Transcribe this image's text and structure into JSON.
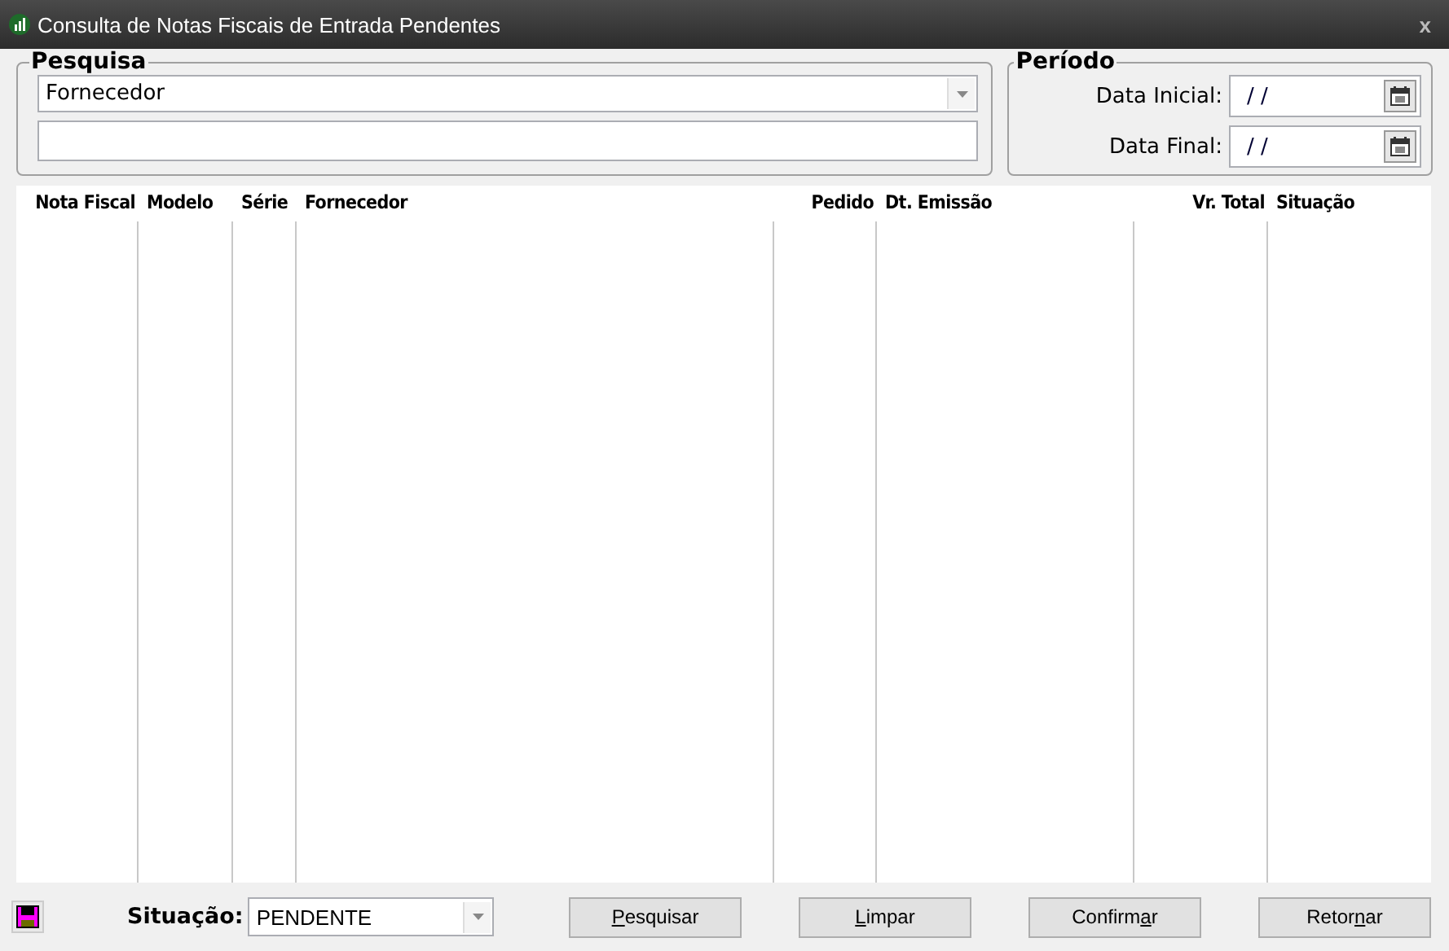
{
  "window": {
    "title": "Consulta de Notas Fiscais de Entrada Pendentes",
    "close": "x"
  },
  "search": {
    "legend": "Pesquisa",
    "field": "Fornecedor"
  },
  "period": {
    "legend": "Período",
    "fields": [
      {
        "label": "Data Inicial:",
        "value": "/  /"
      },
      {
        "label": "Data Final:",
        "value": "/  /"
      }
    ]
  },
  "table": {
    "columns": [
      {
        "label": "Nota Fiscal",
        "right_aligned": true
      },
      {
        "label": "Modelo",
        "right_aligned": false
      },
      {
        "label": "Série",
        "right_aligned": false
      },
      {
        "label": "Fornecedor",
        "right_aligned": false
      },
      {
        "label": "Pedido",
        "right_aligned": true
      },
      {
        "label": "Dt. Emissão",
        "right_aligned": false
      },
      {
        "label": "Vr. Total",
        "right_aligned": true
      },
      {
        "label": "Situação",
        "right_aligned": false
      }
    ]
  },
  "footer": {
    "status_label": "Situação:",
    "status_value": "PENDENTE",
    "buttons": [
      {
        "accelerator": "P",
        "after": "esquisar"
      },
      {
        "accelerator": "L",
        "after": "impar"
      },
      {
        "before": "Confirm",
        "accelerator": "a",
        "after": "r"
      },
      {
        "before": "Retor",
        "accelerator": "n",
        "after": "ar"
      }
    ]
  }
}
